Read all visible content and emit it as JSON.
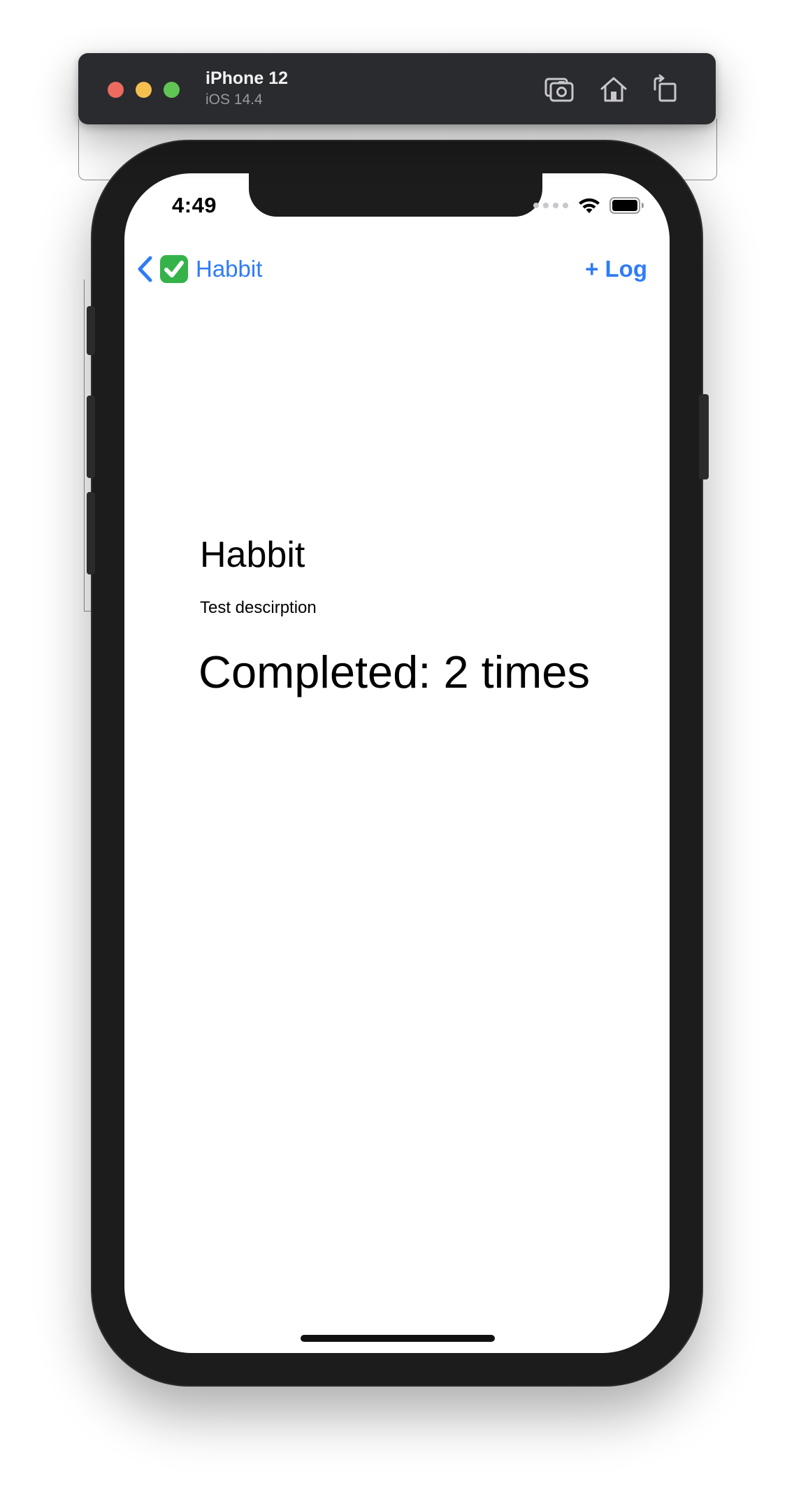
{
  "simulator": {
    "device_name": "iPhone 12",
    "os_version": "iOS 14.4",
    "toolbar": [
      "screenshot-icon",
      "home-icon",
      "rotate-icon"
    ],
    "traffic_lights": {
      "close": "#ed6a5e",
      "minimize": "#f5bf4f",
      "zoom": "#61c554"
    }
  },
  "status_bar": {
    "time": "4:49",
    "icons": [
      "cellular-icon",
      "wifi-icon",
      "battery-icon"
    ]
  },
  "nav_bar": {
    "back_emoji": "✅",
    "back_label": "Habbit",
    "action_label": "+ Log",
    "accent_color": "#2f7cf6"
  },
  "habit": {
    "title": "Habbit",
    "description": "Test descirption",
    "completed_text": "Completed: 2 times"
  }
}
